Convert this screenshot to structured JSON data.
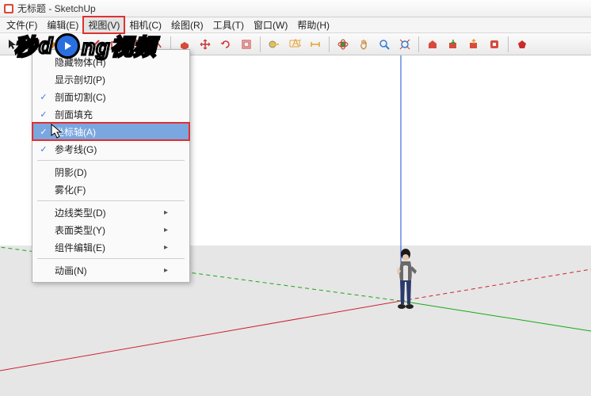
{
  "window": {
    "title": "无标题 - SketchUp"
  },
  "menubar": {
    "items": [
      {
        "label": "文件(F)"
      },
      {
        "label": "编辑(E)"
      },
      {
        "label": "视图(V)",
        "active": true,
        "highlight_box": true
      },
      {
        "label": "相机(C)"
      },
      {
        "label": "绘图(R)"
      },
      {
        "label": "工具(T)"
      },
      {
        "label": "窗口(W)"
      },
      {
        "label": "帮助(H)"
      }
    ]
  },
  "dropdown": {
    "groups": [
      [
        {
          "label": "隐藏物体(H)",
          "checked": false
        },
        {
          "label": "显示剖切(P)",
          "checked": false
        },
        {
          "label": "剖面切割(C)",
          "checked": true
        },
        {
          "label": "剖面填充",
          "checked": true
        },
        {
          "label": "坐标轴(A)",
          "checked": true,
          "highlighted": true,
          "highlight_box": true
        },
        {
          "label": "参考线(G)",
          "checked": true
        }
      ],
      [
        {
          "label": "阴影(D)",
          "checked": false
        },
        {
          "label": "雾化(F)",
          "checked": false
        }
      ],
      [
        {
          "label": "边线类型(D)",
          "submenu": true
        },
        {
          "label": "表面类型(Y)",
          "submenu": true
        },
        {
          "label": "组件编辑(E)",
          "submenu": true
        }
      ],
      [
        {
          "label": "动画(N)",
          "submenu": true
        }
      ]
    ]
  },
  "toolbar_icons": [
    "pointer",
    "line",
    "rect",
    "circle",
    "arc",
    "sep",
    "push",
    "offset",
    "move",
    "rotate",
    "scale",
    "sep",
    "tape",
    "protractor",
    "text",
    "sep",
    "paint",
    "orbit",
    "pan",
    "zoom",
    "zoom-extents",
    "sep",
    "3dwh",
    "layers",
    "outliner",
    "scenes",
    "ruby"
  ],
  "logo": {
    "text1": "秒",
    "text2": "ng视频",
    "brand_d": "d"
  }
}
